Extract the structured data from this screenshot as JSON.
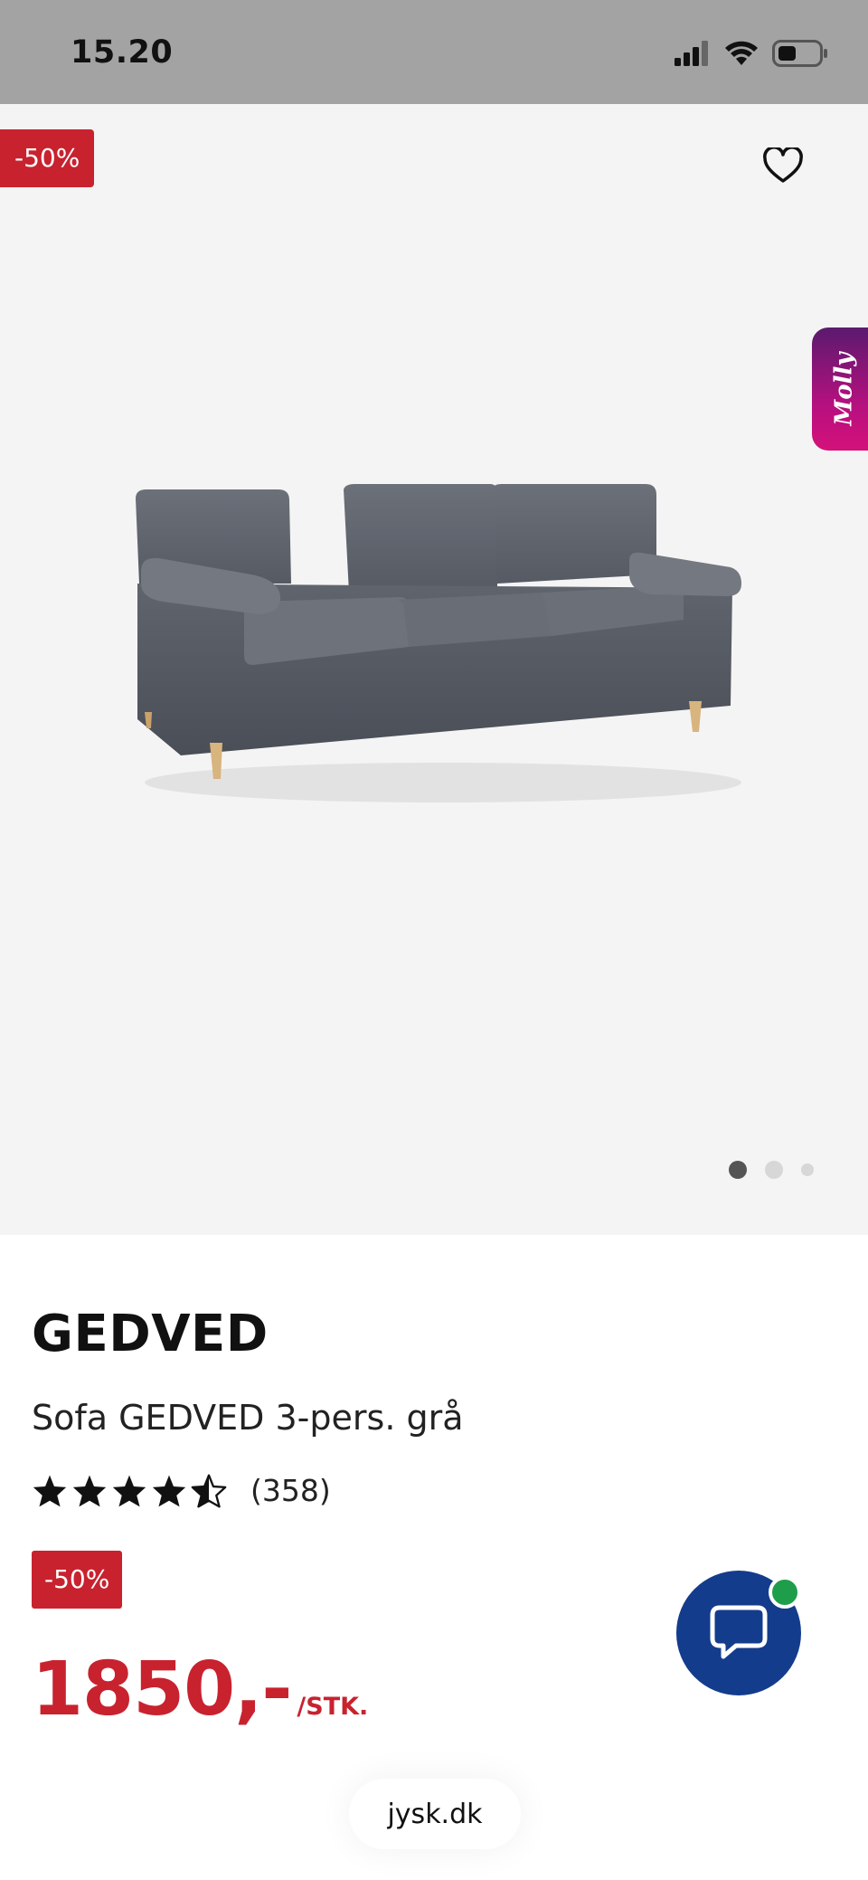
{
  "status_bar": {
    "time": "15.20"
  },
  "gallery": {
    "discount_badge": "-50%",
    "assistant_tab": "Molly",
    "image_alt": "sofa-image",
    "slide_count": 3,
    "active_slide": 1
  },
  "product": {
    "name": "GEDVED",
    "description": "Sofa GEDVED 3-pers. grå",
    "rating": 4.5,
    "review_count": "(358)",
    "discount_badge": "-50%",
    "price": "1850,-",
    "price_unit": "/STK."
  },
  "browser": {
    "url": "jysk.dk"
  },
  "colors": {
    "sale_red": "#c8222f",
    "chat_blue": "#143c8c",
    "online_green": "#1e9e4a"
  }
}
